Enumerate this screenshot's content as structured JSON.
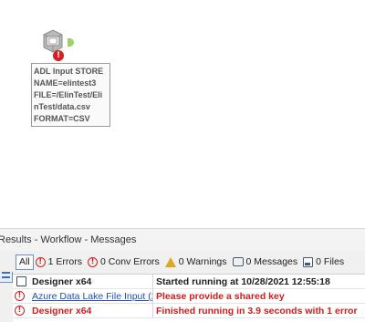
{
  "canvas": {
    "tool": {
      "icon": "adl-input-tool-icon",
      "error_marker": "!",
      "annotation": "ADL Input STORE\nNAME=elintest3\nFILE=/ElinTest/Eli\nnTest/data.csv\nFORMAT=CSV"
    }
  },
  "results": {
    "title": "Results - Workflow - Messages",
    "filters": {
      "all": "All",
      "errors": "1 Errors",
      "conv_errors": "0 Conv Errors",
      "warnings": "0 Warnings",
      "messages": "0 Messages",
      "files": "0 Files"
    },
    "rows": [
      {
        "icon": "message-icon",
        "tool": "Designer x64",
        "message": "Started running at 10/28/2021 12:55:18",
        "style": "normal"
      },
      {
        "icon": "error-icon",
        "tool": "Azure Data Lake File Input (2)",
        "message": "Please provide a shared key",
        "style": "error-link"
      },
      {
        "icon": "error-icon",
        "tool": "Designer x64",
        "message": "Finished running in 3.9 seconds with 1 error",
        "style": "error"
      }
    ],
    "colors": {
      "error": "#d61c1c",
      "link": "#1f4fb8",
      "warning": "#e0a524"
    }
  }
}
